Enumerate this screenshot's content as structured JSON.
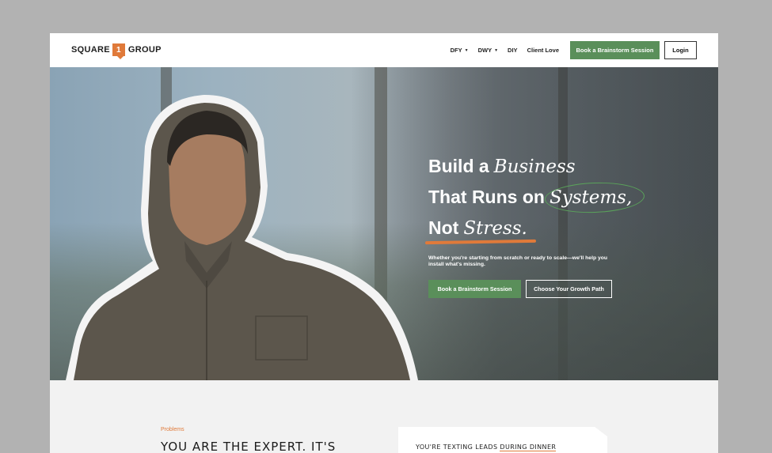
{
  "header": {
    "logo_left": "SQUARE",
    "logo_mark": "1",
    "logo_right": "GROUP",
    "nav": [
      {
        "label": "DFY",
        "has_dropdown": true
      },
      {
        "label": "DWY",
        "has_dropdown": true
      },
      {
        "label": "DIY",
        "has_dropdown": false
      },
      {
        "label": "Client Love",
        "has_dropdown": false
      }
    ],
    "cta_label": "Book a Brainstorm Session",
    "login_label": "Login"
  },
  "hero": {
    "line1_bold": "Build a",
    "line1_script": "Business",
    "line2_bold": "That Runs on",
    "line2_script": "Systems,",
    "line3_bold": "Not",
    "line3_script": "Stress.",
    "subtext": "Whether you're starting from scratch or ready to scale—we'll help you install what's missing.",
    "primary_button": "Book a Brainstorm Session",
    "secondary_button": "Choose Your Growth Path"
  },
  "problems": {
    "label": "Problems",
    "heading": "YOU ARE THE EXPERT. IT'S",
    "note_prefix": "YOU'RE TEXTING LEADS ",
    "note_underlined": "DURING DINNER"
  },
  "colors": {
    "accent_green": "#5a8f5a",
    "accent_orange": "#e07a3a",
    "background": "#f2f2f2"
  }
}
